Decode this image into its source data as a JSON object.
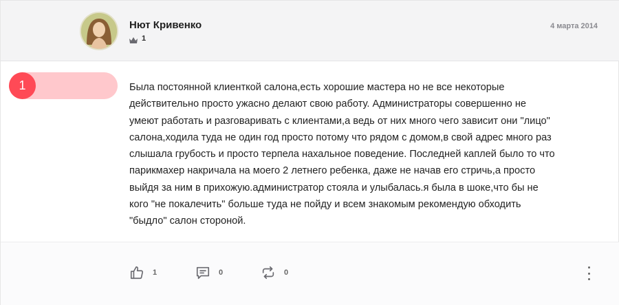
{
  "author": {
    "name": "Нют Кривенко",
    "rank_value": "1"
  },
  "date": "4 марта 2014",
  "rank_badge": "1",
  "review": {
    "text": "Была постоянной клиенткой салона,есть хорошие мастера но не все некоторые\nдействительно просто ужасно делают свою работу. Администраторы совершенно не\nумеют работать и разговаривать с клиентами,а ведь от них много чего зависит они \"лицо\"\nсалона,ходила туда не один год просто потому что рядом с домом,в свой адрес много раз\nслышала грубость и просто терпела нахальное поведение. Последней каплей было то что\nпарикмахер накричала на моего 2 летнего ребенка, даже не начав его стричь,а просто\nвыйдя за ним в прихожую.администратор стояла и улыбалась.я была в шоке,что бы не\nкого \"не покалечить\" больше туда не пойду и всем знакомым рекомендую обходить\n\"быдло\" салон стороной."
  },
  "actions": {
    "likes": "1",
    "comments": "0",
    "reposts": "0"
  },
  "icons": [
    "crown-icon",
    "thumbs-up-icon",
    "comment-icon",
    "repost-icon",
    "more-vertical-icon"
  ],
  "colors": {
    "badge": "#ff4a56",
    "badge_bar": "#ffc8cc",
    "header_bg": "#f4f4f5"
  }
}
